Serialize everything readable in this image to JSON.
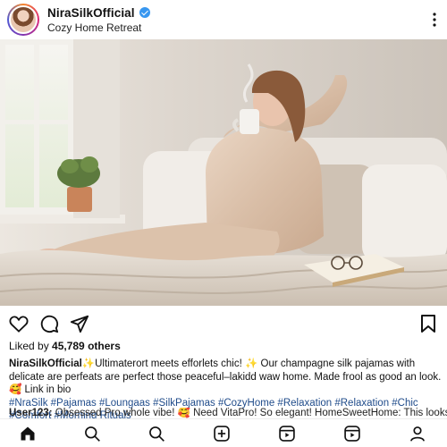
{
  "header": {
    "username": "NiraSilkOfficial",
    "subtitle": "Cozy Home Retreat",
    "more_label": "⋮"
  },
  "post": {
    "image_alt": "Woman in champagne silk pajamas sipping from a mug on a cozy bed",
    "likes_prefix": "Liked by ",
    "likes_count": "45,789",
    "likes_suffix": " others"
  },
  "caption": {
    "username": "NiraSilkOfficial",
    "text": "✨Ultimaterort meets efforlets chic! ✨ Our champagne silk pajamas with delicate are perfeats are perfect those peaceful–lakidd waw home.  Made frool as good an look.  🥰 Link in bio",
    "hashtags": "#NraSilk #Pajamas #Loungaas #SilkPajamas #CozyHome #Relaxation  #Relaxation  #Chic #Comfort #Morning Rituals"
  },
  "comment": {
    "username": "User123:",
    "text": " Obsessed Pro whole vibe! 🥰 Need VitaPro! So elegant! HomeSweetHome: This looks to pure bliss!"
  },
  "icons": {
    "like": "heart-icon",
    "comment": "comment-icon",
    "share": "paper-plane-icon",
    "save": "bookmark-icon",
    "nav": [
      "home-icon",
      "search-icon",
      "search-icon",
      "create-post-icon",
      "reels-icon",
      "reels-icon",
      "profile-icon"
    ]
  },
  "colors": {
    "verified": "#3897f0",
    "hashtag": "#1f4b8a",
    "text": "#111111"
  }
}
